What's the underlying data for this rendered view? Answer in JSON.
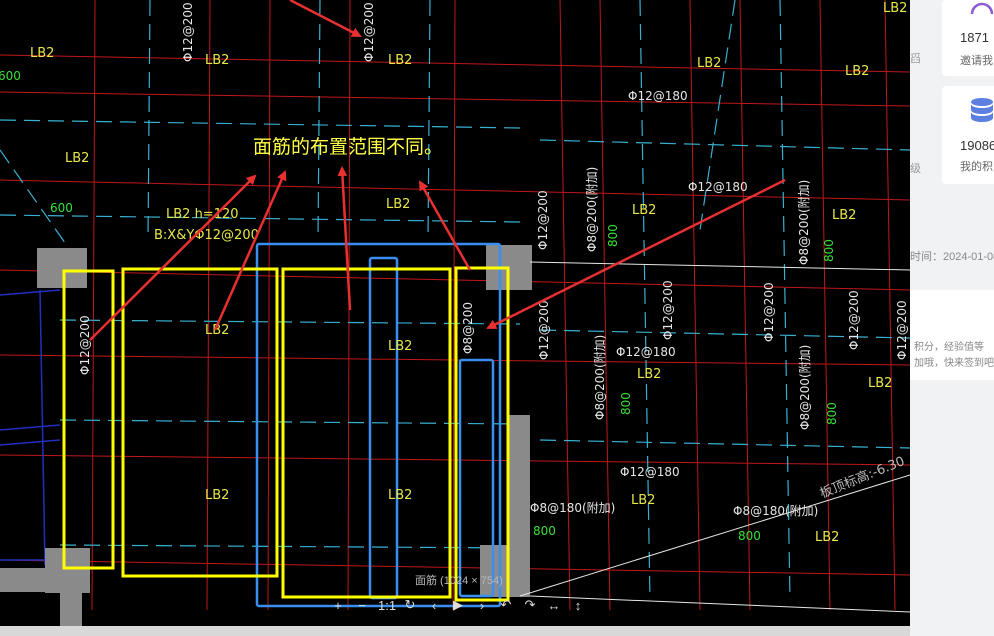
{
  "viewer": {
    "caption": "面筋的布置范围不同。",
    "image_info": "面筋 (1024 × 754)",
    "toolbar": [
      "+",
      "−",
      "1:1",
      "↻",
      "‹",
      "▶",
      "›",
      "↶",
      "↷",
      "↔",
      "↕"
    ]
  },
  "drawing": {
    "slab_labels": [
      "LB2",
      "LB2",
      "LB2",
      "LB2",
      "LB2",
      "LB2",
      "LB2",
      "LB2",
      "LB2",
      "LB2",
      "LB2",
      "LB2",
      "LB2",
      "LB2",
      "LB2",
      "LB2",
      "LB2",
      "LB2"
    ],
    "rebar_labels": [
      "Φ12@200",
      "Φ12@200",
      "Φ12@180",
      "Φ12@180",
      "Φ12@200",
      "Φ12@200",
      "Φ12@200",
      "Φ8@200",
      "Φ12@200",
      "Φ12@200",
      "Φ12@180",
      "Φ12@180",
      "Φ8@180(附加)",
      "Φ8@180(附加)",
      "Φ8@200(附加)",
      "Φ8@200(附加)",
      "Φ8@200(附加)",
      "Φ8@200(附加)",
      "Φ12@200",
      "Φ12@200"
    ],
    "green_labels": [
      "600",
      "800",
      "800",
      "800",
      "800",
      "800",
      "800",
      "600"
    ],
    "slab_note_1": "LB2  h=120",
    "slab_note_2": "B:X&YΦ12@200",
    "elevation_note": "板顶标高:-6.30"
  },
  "sidebar": {
    "card1": {
      "number": "1871",
      "label": "邀请我"
    },
    "card2": {
      "number": "19086",
      "label": "我的积"
    },
    "left_cut_1": "舀",
    "left_cut_2": "级",
    "time_text": "时间：2024-01-08",
    "tip_line_1": "积分，经验值等",
    "tip_line_2": "加哦，快来签到吧"
  },
  "colors": {
    "grid_red": "#d42020",
    "grid_cyan": "#40b8d8",
    "highlight_yellow": "#ffff00",
    "beam_blue": "#3a8ef0",
    "arrow_red": "#e83030"
  }
}
